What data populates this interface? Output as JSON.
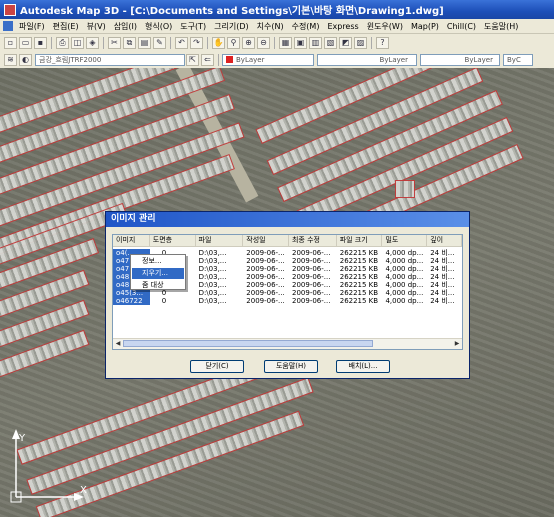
{
  "window": {
    "title": "Autodesk Map 3D - [C:\\Documents and Settings\\기본\\바탕 화면\\Drawing1.dwg]"
  },
  "menu": [
    "파일(F)",
    "편집(E)",
    "뷰(V)",
    "삽입(I)",
    "형식(O)",
    "도구(T)",
    "그리기(D)",
    "치수(N)",
    "수정(M)",
    "Express",
    "윈도우(W)",
    "Map(P)",
    "Chill(C)",
    "도움말(H)"
  ],
  "toolbar": {
    "layer_current": "금강_흐림JTRF2000",
    "color_value": "ByLayer",
    "linetype_value": "ByLayer",
    "lineweight_value": "ByLayer",
    "plot_style_value": "ByC"
  },
  "dialog": {
    "title": "이미지 관리",
    "columns": [
      "이미지",
      "도면층",
      "파일",
      "작성일",
      "최종 수정",
      "파일 크기",
      "밀도",
      "깊이"
    ],
    "rows": [
      [
        "o4(...",
        "0",
        "D:\\03,...",
        "2009-06-...",
        "2009-06-...",
        "262215 KB",
        "4,000 dp...",
        "24 비..."
      ],
      [
        "o47...",
        "0",
        "D:\\03,...",
        "2009-06-...",
        "2009-06-...",
        "262215 KB",
        "4,000 dp...",
        "24 비..."
      ],
      [
        "o47...",
        "0",
        "D:\\03,...",
        "2009-06-...",
        "2009-06-...",
        "262215 KB",
        "4,000 dp...",
        "24 비..."
      ],
      [
        "o48...",
        "0",
        "D:\\03,...",
        "2009-06-...",
        "2009-06-...",
        "262215 KB",
        "4,000 dp...",
        "24 비..."
      ],
      [
        "o48...",
        "0",
        "D:\\03,...",
        "2009-06-...",
        "2009-06-...",
        "262215 KB",
        "4,000 dp...",
        "24 비..."
      ],
      [
        "o45(3...",
        "0",
        "D:\\03,...",
        "2009-06-...",
        "2009-06-...",
        "262215 KB",
        "4,000 dp...",
        "24 비..."
      ],
      [
        "o46722",
        "0",
        "D:\\03,...",
        "2009-06-...",
        "2009-06-...",
        "262215 KB",
        "4,000 dp...",
        "24 비..."
      ]
    ],
    "buttons": {
      "close": "닫기(C)",
      "help": "도움말(H)",
      "place": "배치(L)..."
    }
  },
  "context_menu": [
    "정보...",
    "지우기...",
    "줌 대상"
  ],
  "ucs": {
    "x_label": "X",
    "y_label": "Y"
  }
}
